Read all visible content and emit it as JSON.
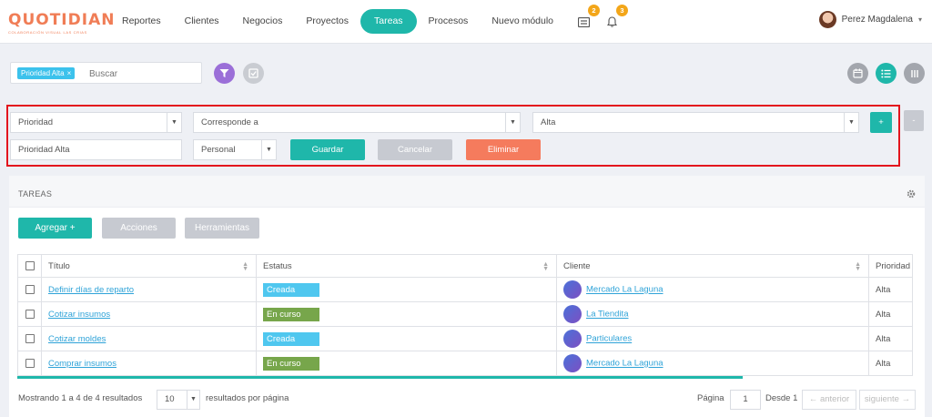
{
  "brand": {
    "name": "QUOTIDIAN",
    "tagline": "COLABORACIÓN VISUAL LAS CRIAS"
  },
  "nav": {
    "items": [
      {
        "label": "Reportes"
      },
      {
        "label": "Clientes"
      },
      {
        "label": "Negocios"
      },
      {
        "label": "Proyectos"
      },
      {
        "label": "Tareas",
        "active": true
      },
      {
        "label": "Procesos"
      },
      {
        "label": "Nuevo módulo"
      }
    ]
  },
  "notifications": {
    "messages_count": "2",
    "alerts_count": "3"
  },
  "user": {
    "name": "Perez Magdalena"
  },
  "search": {
    "chip": "Prioridad Alta",
    "chip_remove": "×",
    "placeholder": "Buscar"
  },
  "filter": {
    "field": "Prioridad",
    "operator": "Corresponde a",
    "value": "Alta",
    "add_label": "+",
    "remove_label": "-",
    "name": "Prioridad Alta",
    "scope": "Personal",
    "save_label": "Guardar",
    "cancel_label": "Cancelar",
    "delete_label": "Eliminar"
  },
  "tasks": {
    "title": "TAREAS",
    "add_label": "Agregar +",
    "actions_label": "Acciones",
    "tools_label": "Herramientas",
    "columns": [
      "Título",
      "Estatus",
      "Cliente",
      "Prioridad"
    ],
    "rows": [
      {
        "title": "Definir días de reparto",
        "status": "Creada",
        "client": "Mercado La Laguna",
        "priority": "Alta"
      },
      {
        "title": "Cotizar insumos",
        "status": "En curso",
        "client": "La Tiendita",
        "priority": "Alta"
      },
      {
        "title": "Cotizar moldes",
        "status": "Creada",
        "client": "Particulares",
        "priority": "Alta"
      },
      {
        "title": "Comprar insumos",
        "status": "En curso",
        "client": "Mercado La Laguna",
        "priority": "Alta"
      }
    ]
  },
  "status_colors": {
    "Creada": "#4fc7ef",
    "En curso": "#77a64b"
  },
  "footer": {
    "showing": "Mostrando 1 a 4 de 4 resultados",
    "per_page": "10",
    "per_page_label": "resultados por página",
    "page_label": "Página",
    "page": "1",
    "of_label": "Desde 1",
    "prev": "← anterior",
    "next": "siguiente →"
  },
  "colors": {
    "accent": "#1fb7aa",
    "brand": "#f07d56",
    "danger": "#f57b5d",
    "filter_btn": "#9b6fd8"
  }
}
